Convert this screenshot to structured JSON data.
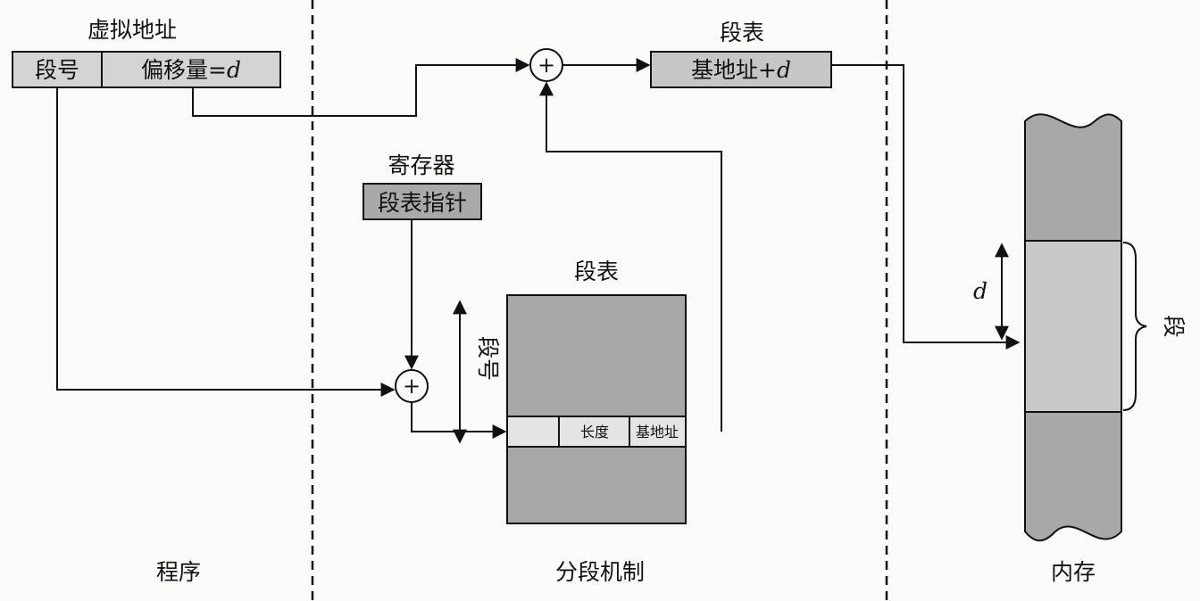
{
  "program": {
    "virtual_address_title": "虚拟地址",
    "segment_number": "段号",
    "offset_prefix": "偏移量=",
    "offset_var": "d",
    "section_label": "程序"
  },
  "mechanism": {
    "register_title": "寄存器",
    "segment_table_pointer": "段表指针",
    "segment_table_title": "段表",
    "segment_number_vertical": "段号",
    "entry_length": "长度",
    "entry_base": "基地址",
    "section_label": "分段机制",
    "adder_symbol": "+"
  },
  "top_path": {
    "segment_table_title": "段表",
    "base_plus": "基地址+",
    "offset_var": "d",
    "adder_symbol": "+"
  },
  "memory": {
    "offset_var": "d",
    "segment_label": "段",
    "section_label": "内存"
  }
}
